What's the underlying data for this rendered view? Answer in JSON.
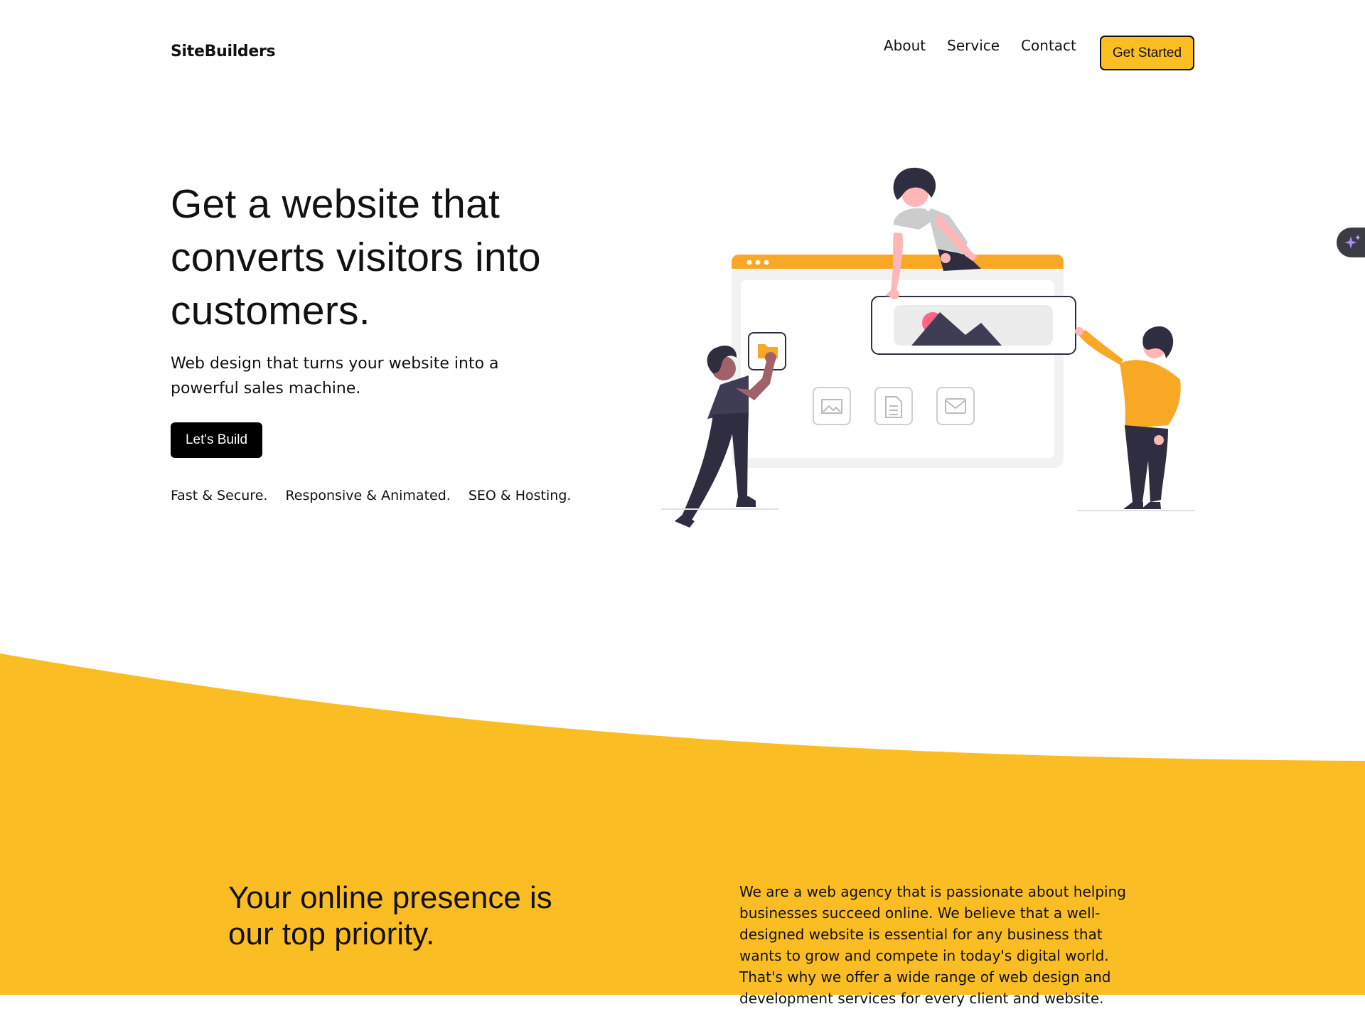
{
  "header": {
    "logo": "SiteBuilders",
    "nav": [
      "About",
      "Service",
      "Contact"
    ],
    "cta": "Get Started"
  },
  "hero": {
    "title": "Get a website that converts visitors into customers.",
    "subtitle": "Web design that turns your website into a powerful sales machine.",
    "button": "Let's Build",
    "features": [
      "Fast & Secure.",
      "Responsive & Animated.",
      "SEO & Hosting."
    ]
  },
  "illustration": {
    "icons": [
      "folder-icon",
      "image-icon",
      "document-icon",
      "mail-icon",
      "mountain-image-icon"
    ],
    "colors": {
      "accent": "#f9a826",
      "dark": "#2f2e41",
      "skin": "#ffb6b6",
      "gray": "#f2f2f2"
    }
  },
  "side_widget": {
    "icon": "sparkles-icon"
  },
  "about": {
    "title": "Your online presence is our top priority.",
    "text": "We are a web agency that is passionate about helping businesses succeed online. We believe that a well-designed website is essential for any business that wants to grow and compete in today's digital world. That's why we offer a wide range of web design and development services for every client and website."
  },
  "colors": {
    "yellow": "#fbbd24",
    "black": "#000000",
    "white": "#ffffff"
  }
}
